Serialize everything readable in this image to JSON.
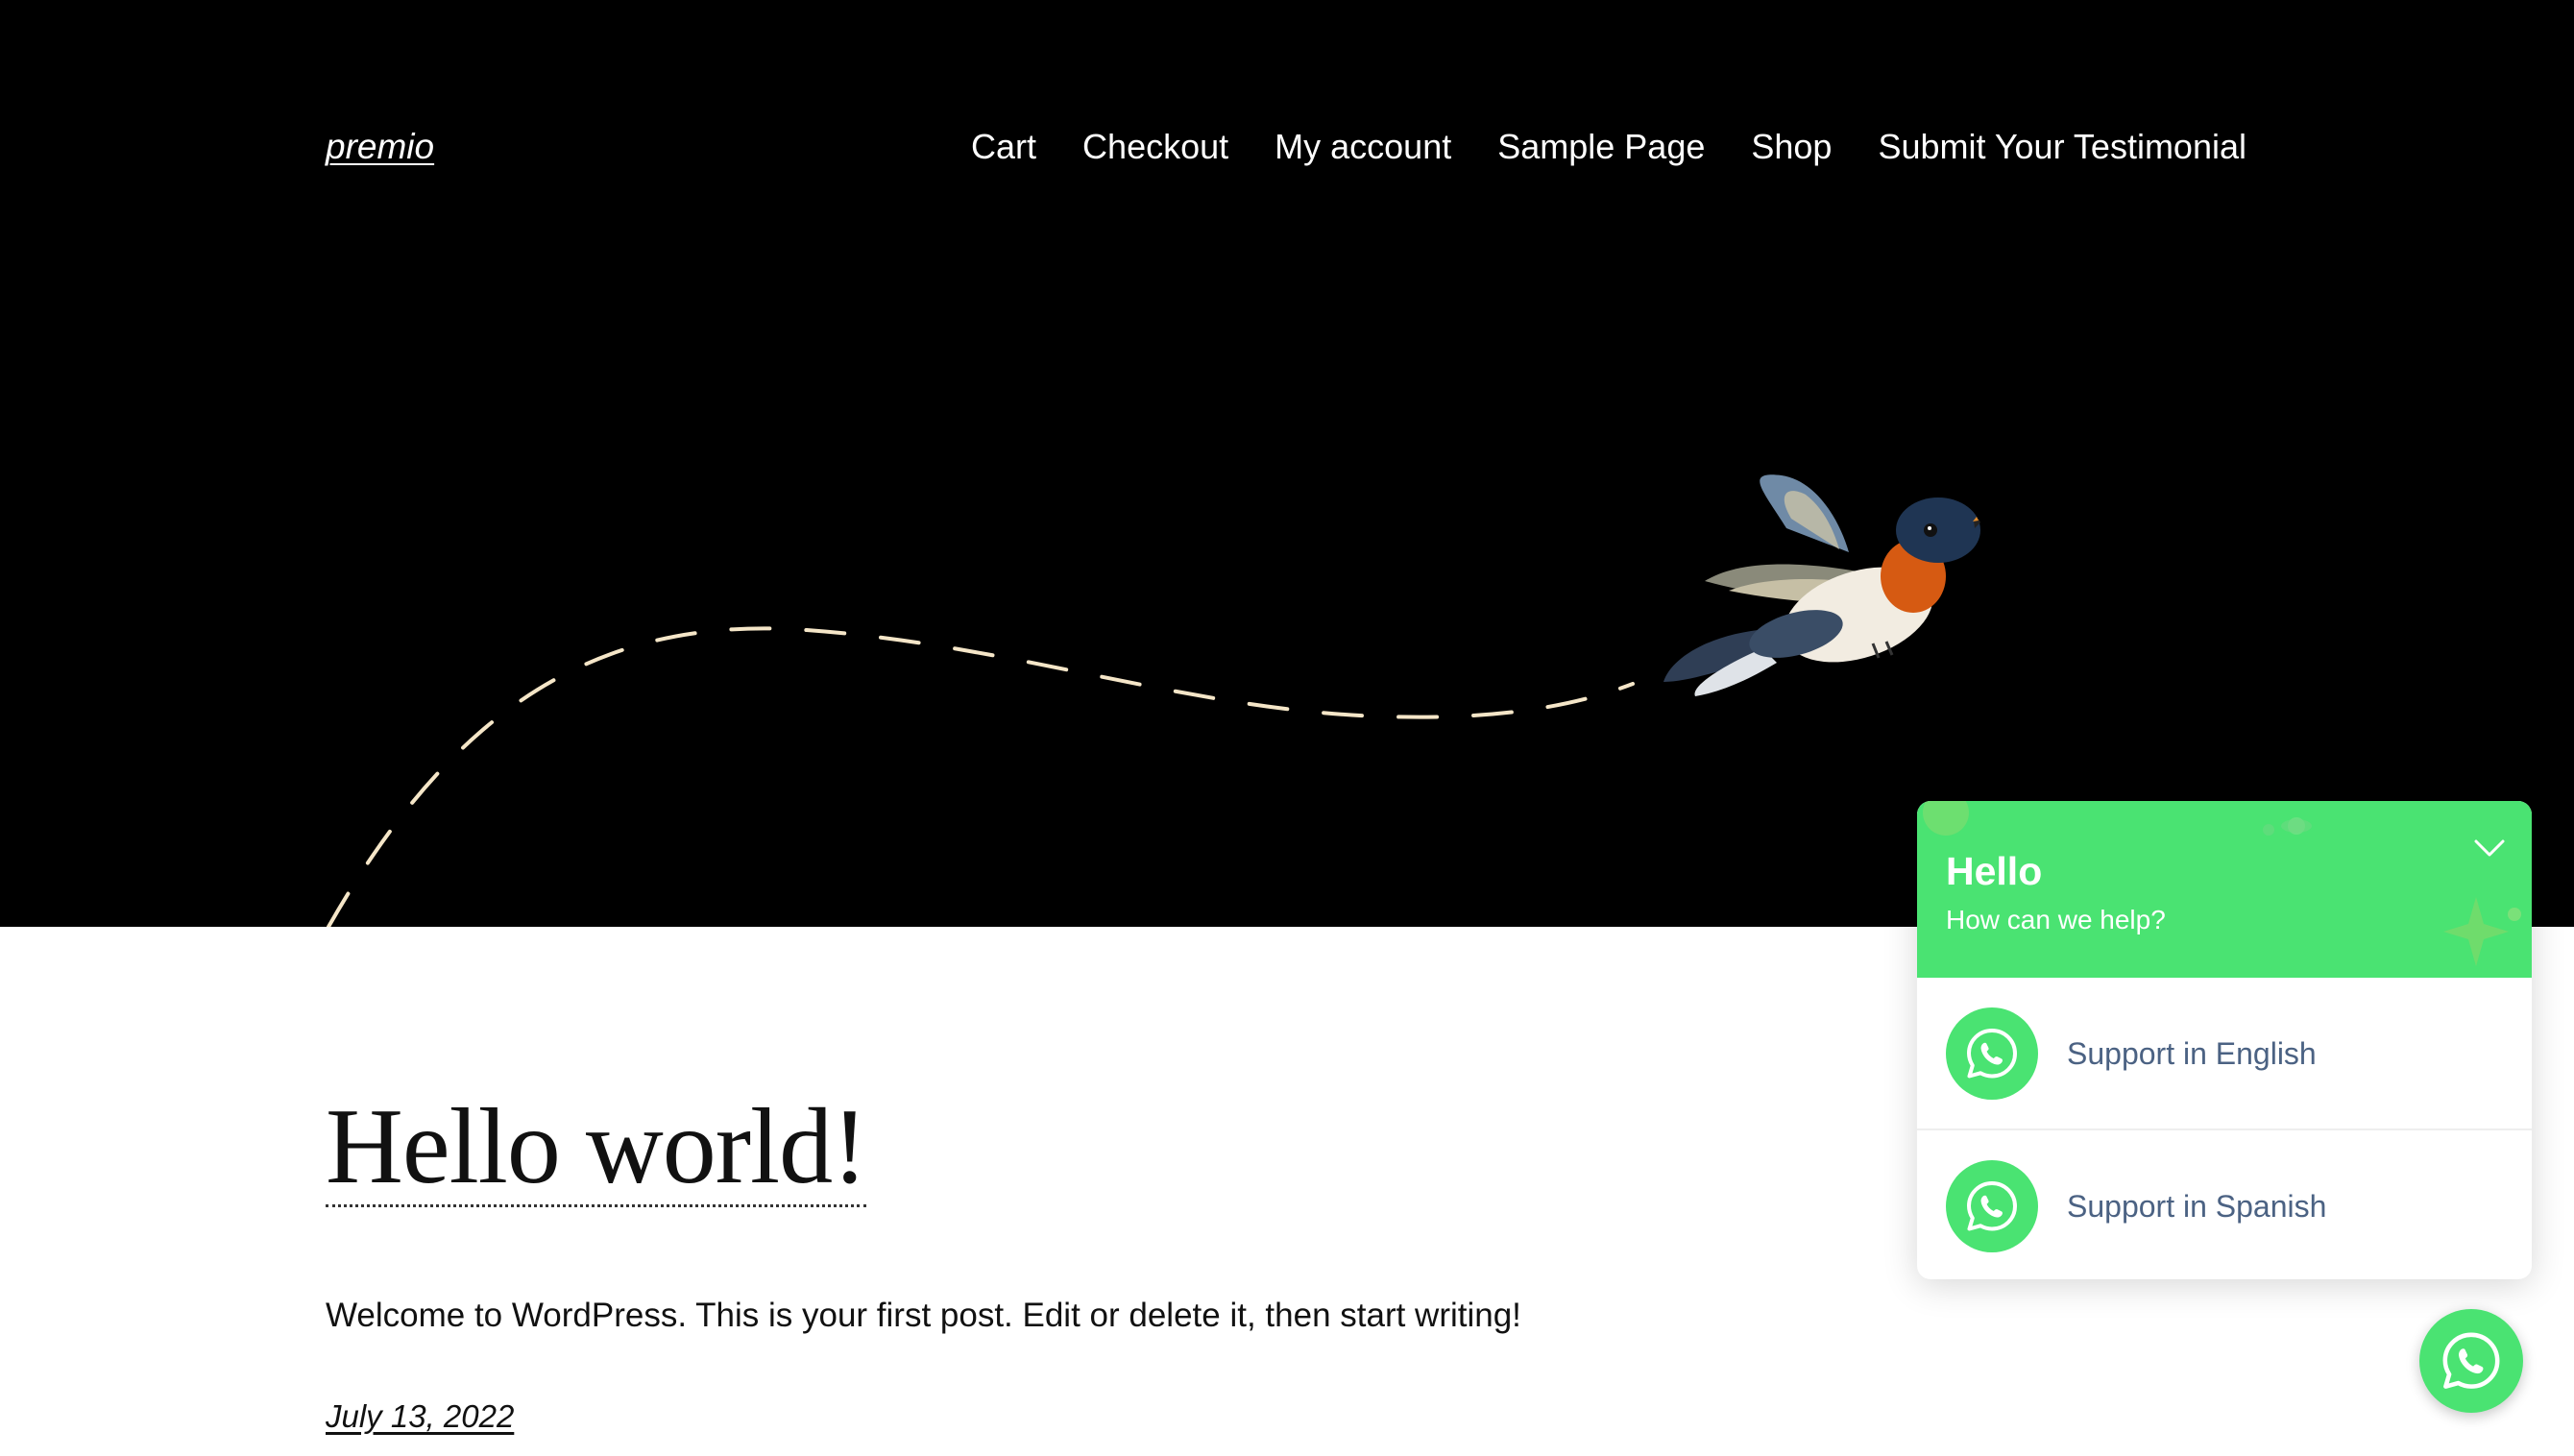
{
  "site": {
    "title": "premio"
  },
  "nav": {
    "items": [
      {
        "label": "Cart"
      },
      {
        "label": "Checkout"
      },
      {
        "label": "My account"
      },
      {
        "label": "Sample Page"
      },
      {
        "label": "Shop"
      },
      {
        "label": "Submit Your Testimonial"
      }
    ]
  },
  "post": {
    "title": "Hello world!",
    "excerpt": "Welcome to WordPress. This is your first post. Edit or delete it, then start writing!",
    "date": "July 13, 2022"
  },
  "chat_widget": {
    "greeting": "Hello",
    "subtitle": "How can we help?",
    "close_icon": "chevron-down-icon",
    "agents": [
      {
        "label": "Support in English",
        "icon": "whatsapp-icon"
      },
      {
        "label": "Support in Spanish",
        "icon": "whatsapp-icon"
      }
    ],
    "fab_icon": "whatsapp-icon",
    "accent_color": "#4ae372"
  },
  "hero": {
    "background_color": "#000000",
    "path_color": "#f5e6c8",
    "illustration": "hummingbird"
  }
}
